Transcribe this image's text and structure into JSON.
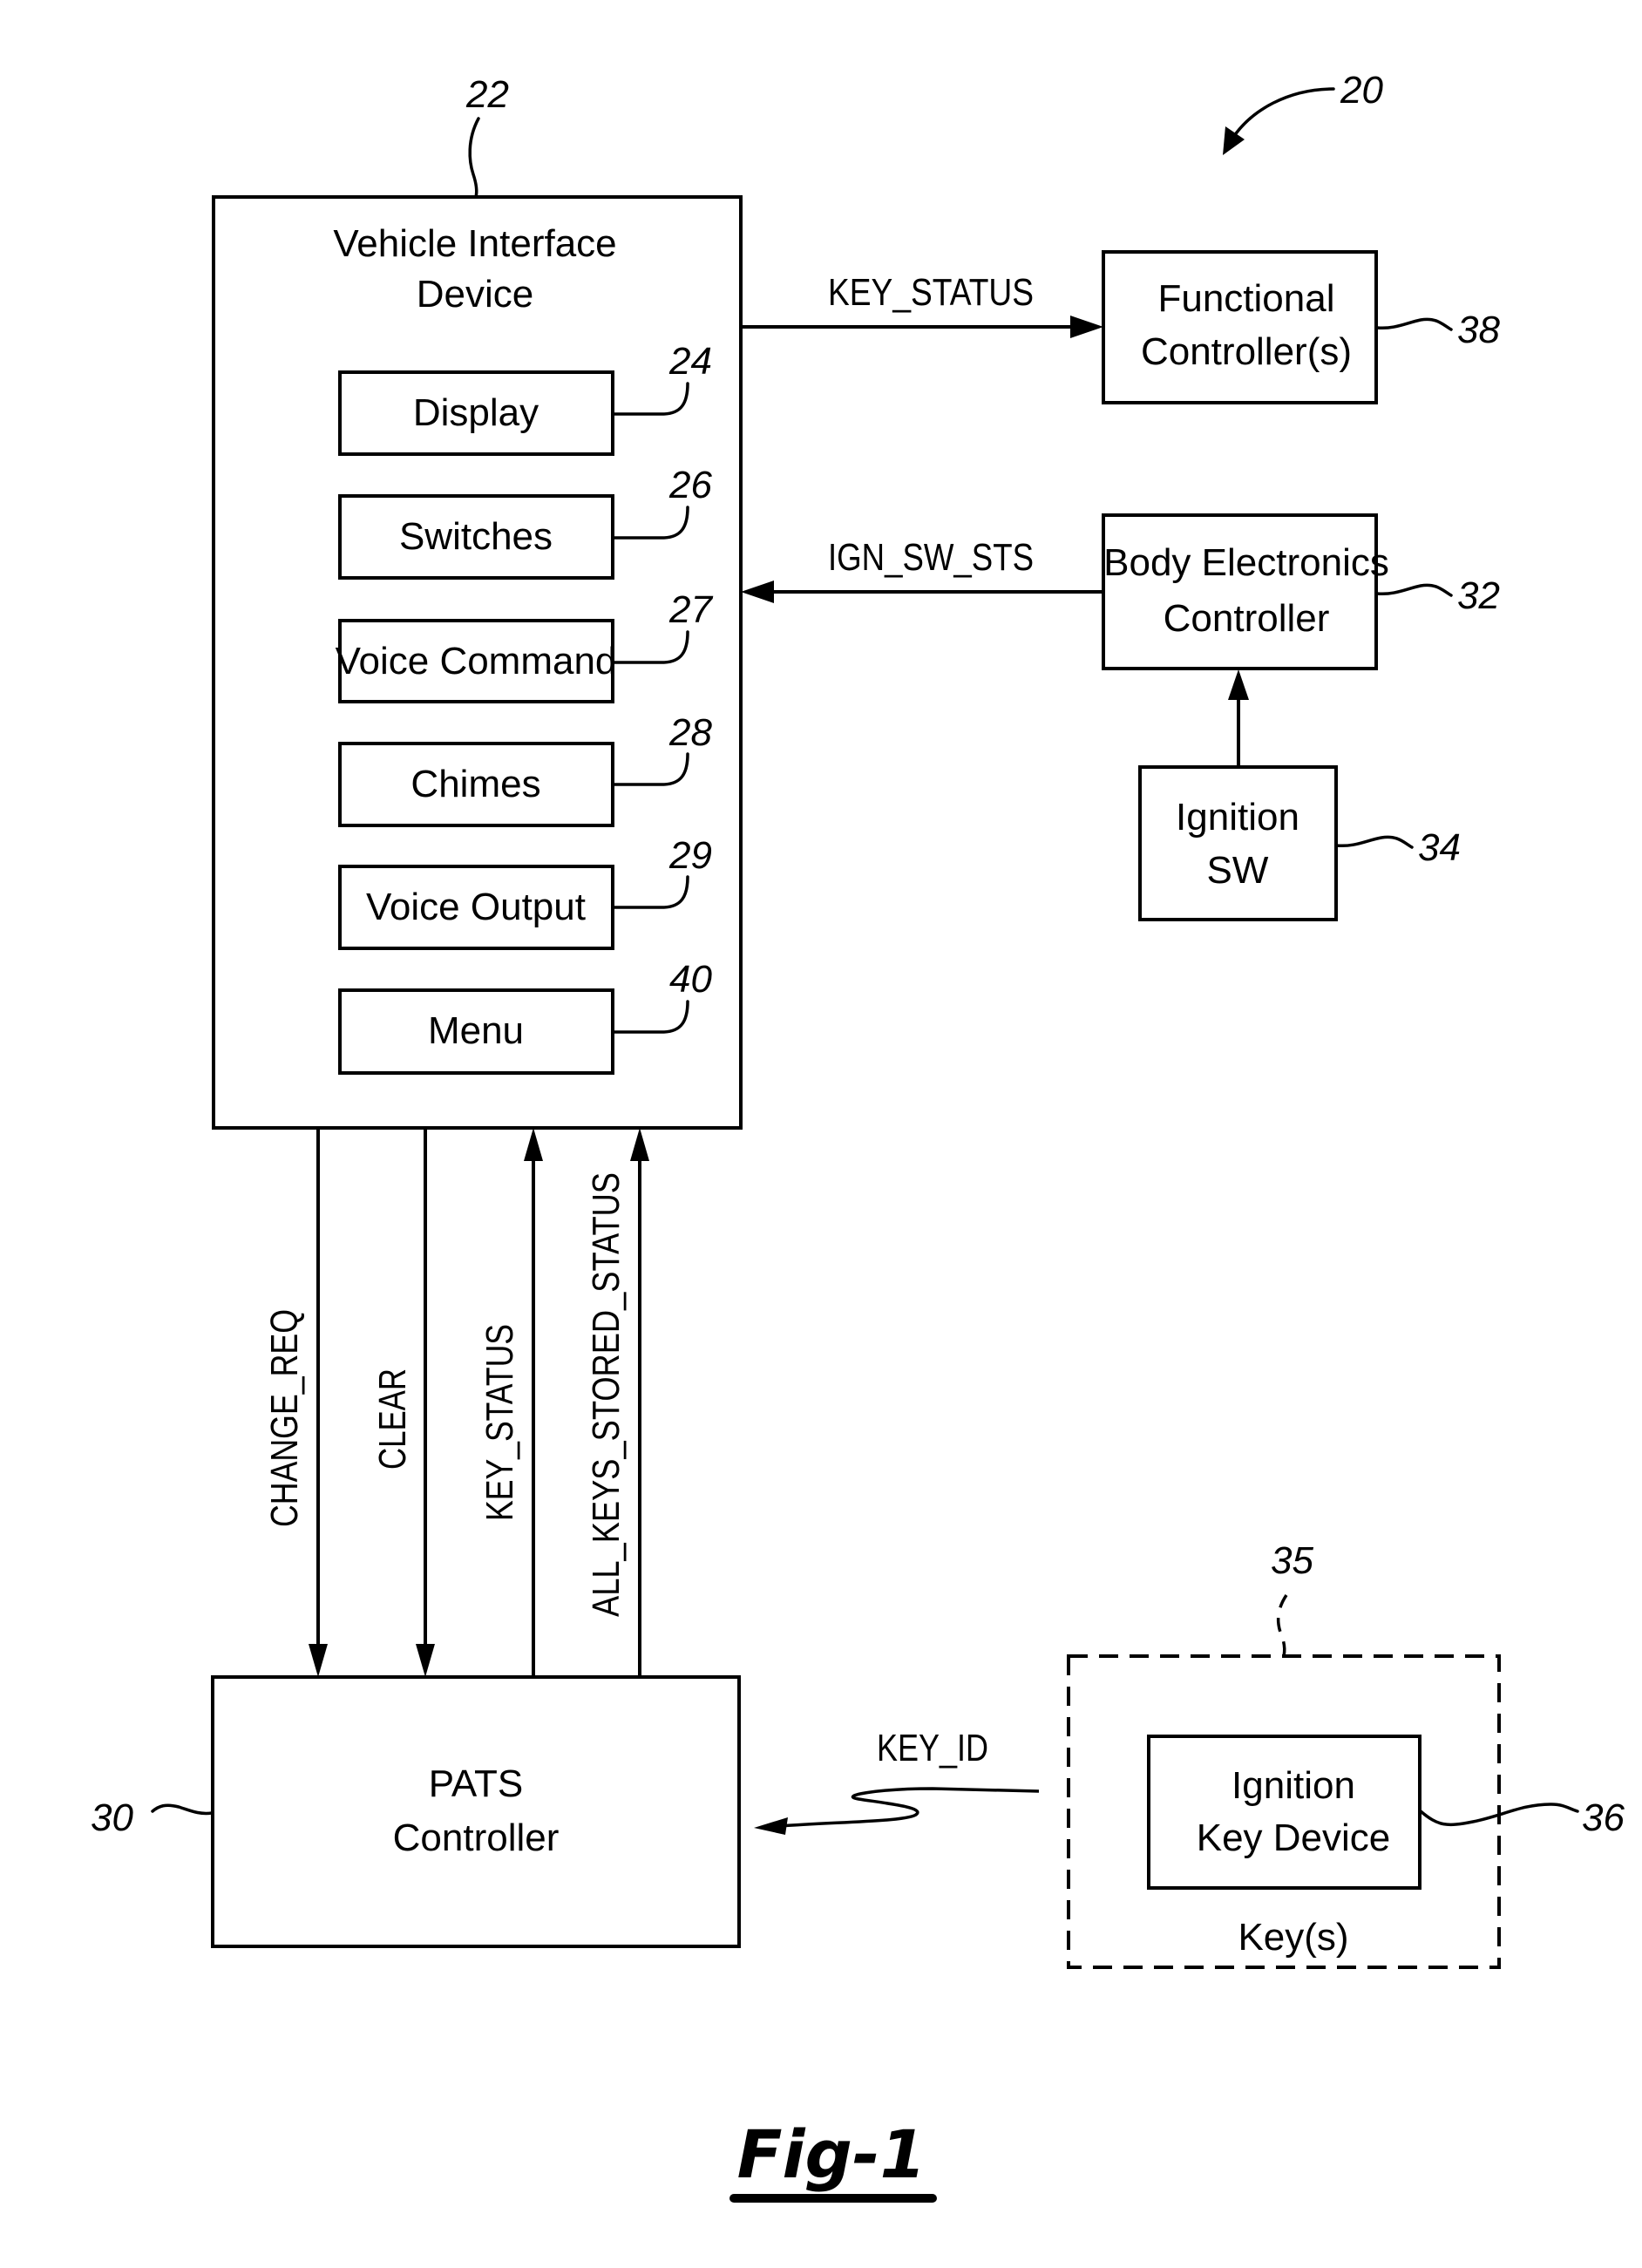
{
  "figure": {
    "label": "Fig-1",
    "system_ref": "20"
  },
  "vehicle_interface_device": {
    "ref": "22",
    "title_line1": "Vehicle Interface",
    "title_line2": "Device",
    "components": [
      {
        "ref": "24",
        "label": "Display"
      },
      {
        "ref": "26",
        "label": "Switches"
      },
      {
        "ref": "27",
        "label": "Voice Command"
      },
      {
        "ref": "28",
        "label": "Chimes"
      },
      {
        "ref": "29",
        "label": "Voice Output"
      },
      {
        "ref": "40",
        "label": "Menu"
      }
    ]
  },
  "functional_controllers": {
    "ref": "38",
    "line1": "Functional",
    "line2": "Controller(s)"
  },
  "body_electronics_controller": {
    "ref": "32",
    "line1": "Body Electronics",
    "line2": "Controller"
  },
  "ignition_switch": {
    "ref": "34",
    "line1": "Ignition",
    "line2": "SW"
  },
  "pats_controller": {
    "ref": "30",
    "line1": "PATS",
    "line2": "Controller"
  },
  "keys_group": {
    "ref": "35",
    "caption": "Key(s)",
    "ignition_key_device": {
      "ref": "36",
      "line1": "Ignition",
      "line2": "Key Device"
    }
  },
  "signals": {
    "key_status_to_functional": "KEY_STATUS",
    "ign_sw_sts": "IGN_SW_STS",
    "change_req": "CHANGE_REQ",
    "clear": "CLEAR",
    "key_status_to_vid": "KEY_STATUS",
    "all_keys_stored_status": "ALL_KEYS_STORED_STATUS",
    "key_id": "KEY_ID"
  }
}
